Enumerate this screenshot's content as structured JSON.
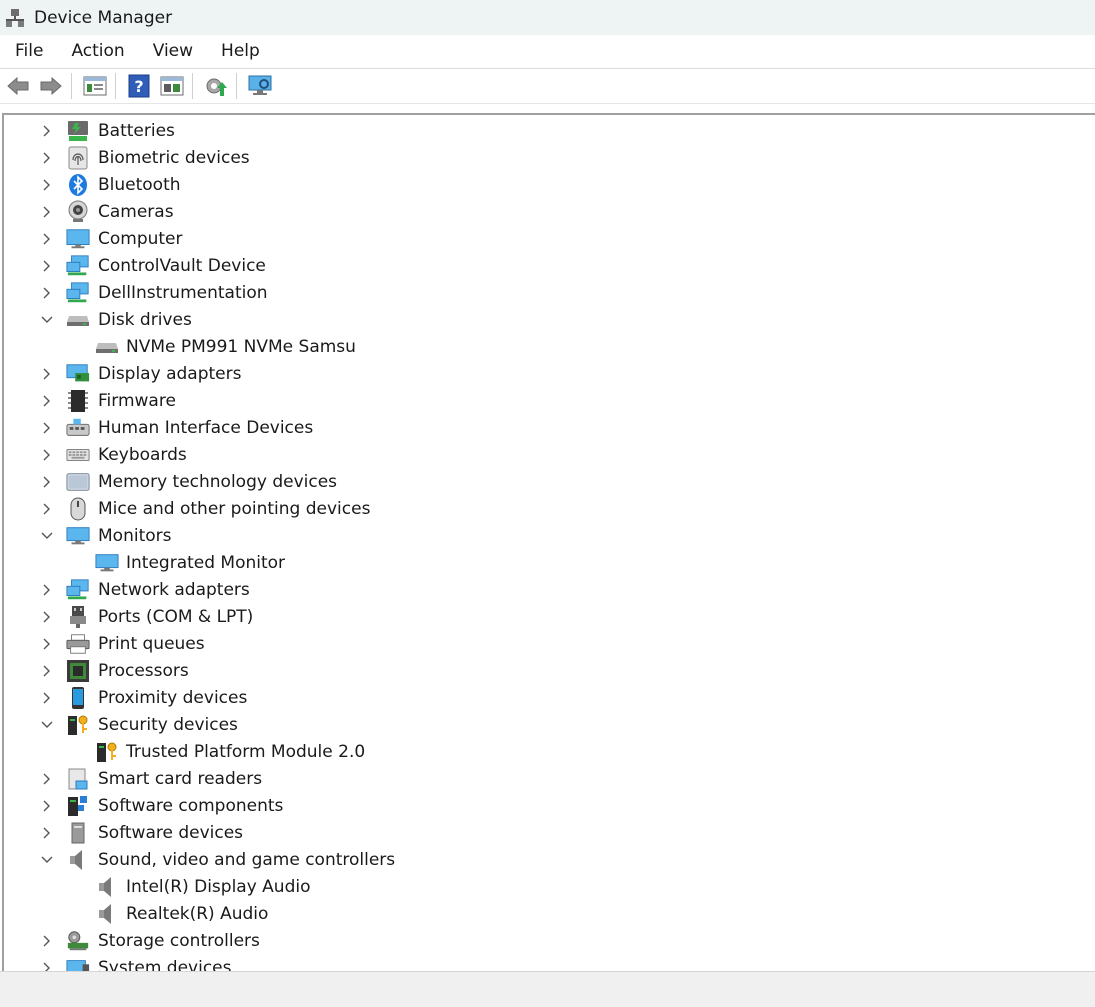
{
  "window": {
    "title": "Device Manager",
    "icon": "device-manager-icon"
  },
  "menu": {
    "file": "File",
    "action": "Action",
    "view": "View",
    "help": "Help"
  },
  "toolbar": {
    "buttons": [
      "back-arrow-icon",
      "forward-arrow-icon",
      "properties-icon",
      "help-icon",
      "show-hidden-icon",
      "update-driver-icon",
      "scan-hardware-icon"
    ]
  },
  "tree": {
    "batteries": "Batteries",
    "biometric": "Biometric devices",
    "bluetooth": "Bluetooth",
    "cameras": "Cameras",
    "computer": "Computer",
    "controlvault": "ControlVault Device",
    "dellinstrumentation": "DellInstrumentation",
    "disk_drives": "Disk drives",
    "disk_nvme": "NVMe PM991 NVMe Samsu",
    "display_adapters": "Display adapters",
    "firmware": "Firmware",
    "hid": "Human Interface Devices",
    "keyboards": "Keyboards",
    "memory": "Memory technology devices",
    "mice": "Mice and other pointing devices",
    "monitors": "Monitors",
    "integrated_monitor": "Integrated Monitor",
    "network": "Network adapters",
    "ports": "Ports (COM & LPT)",
    "print_queues": "Print queues",
    "processors": "Processors",
    "proximity": "Proximity devices",
    "security": "Security devices",
    "tpm": "Trusted Platform Module 2.0",
    "smart_card": "Smart card readers",
    "software_components": "Software components",
    "software_devices": "Software devices",
    "sound": "Sound, video and game controllers",
    "intel_audio": "Intel(R) Display Audio",
    "realtek_audio": "Realtek(R) Audio",
    "storage": "Storage controllers",
    "system": "System devices"
  },
  "colors": {
    "titlebar_bg": "#eef4f4",
    "monitor_blue": "#2b9be0",
    "status_bg": "#f0f0f0"
  }
}
